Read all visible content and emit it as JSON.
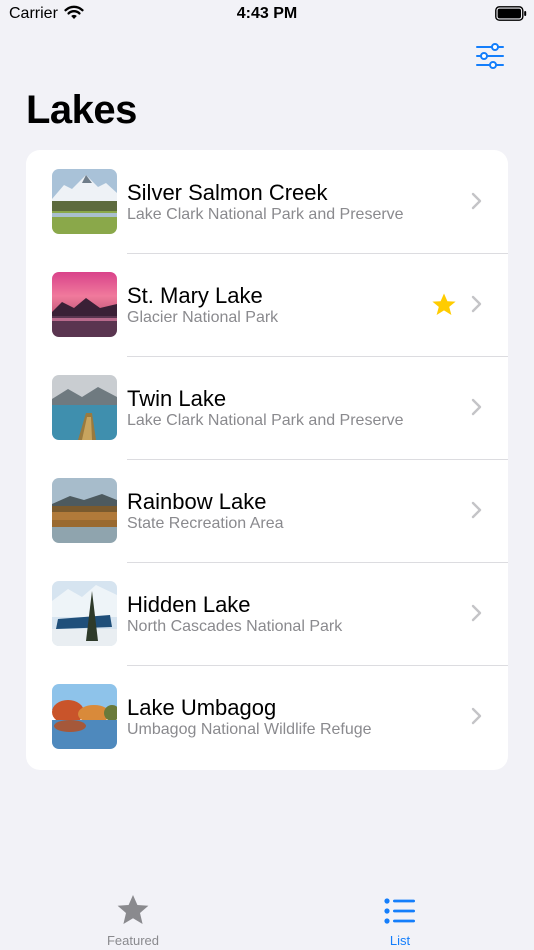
{
  "status_bar": {
    "carrier": "Carrier",
    "time": "4:43 PM"
  },
  "header": {
    "title": "Lakes",
    "filter_icon": "sliders-icon"
  },
  "lakes": [
    {
      "name": "Silver Salmon Creek",
      "park": "Lake Clark National Park and Preserve",
      "favorite": false
    },
    {
      "name": "St. Mary Lake",
      "park": "Glacier National Park",
      "favorite": true
    },
    {
      "name": "Twin Lake",
      "park": "Lake Clark National Park and Preserve",
      "favorite": false
    },
    {
      "name": "Rainbow Lake",
      "park": "State Recreation Area",
      "favorite": false
    },
    {
      "name": "Hidden Lake",
      "park": "North Cascades National Park",
      "favorite": false
    },
    {
      "name": "Lake Umbagog",
      "park": "Umbagog National Wildlife Refuge",
      "favorite": false
    }
  ],
  "tabs": [
    {
      "label": "Featured",
      "icon": "star-icon",
      "selected": false
    },
    {
      "label": "List",
      "icon": "list-icon",
      "selected": true
    }
  ],
  "colors": {
    "accent": "#147efb",
    "inactive": "#8a8a8e",
    "favorite": "#ffcc00",
    "background": "#f2f2f7"
  }
}
